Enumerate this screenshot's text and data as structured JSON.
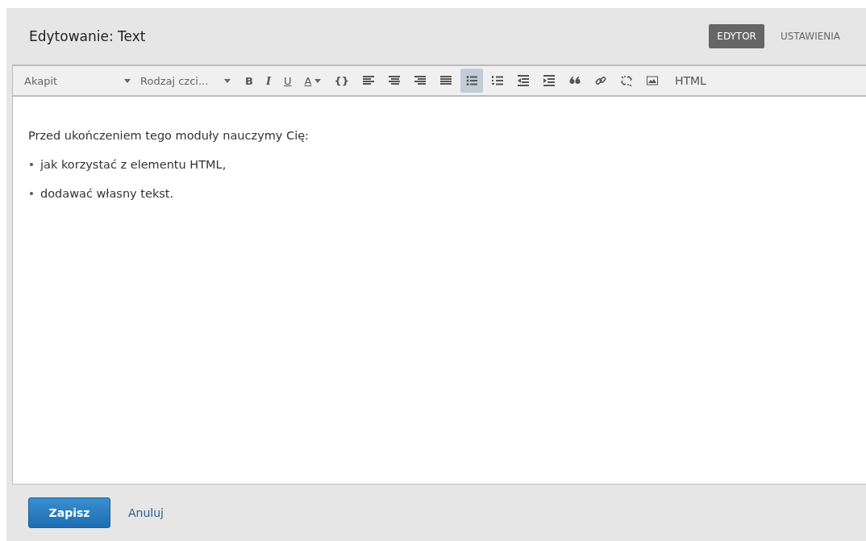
{
  "header": {
    "title": "Edytowanie: Text"
  },
  "tabs": [
    {
      "label": "EDYTOR",
      "selected": true
    },
    {
      "label": "USTAWIENIA",
      "selected": false
    }
  ],
  "toolbar": {
    "dropdowns": [
      {
        "label": "Akapit"
      },
      {
        "label": "Rodzaj czci..."
      }
    ],
    "formats": [
      {
        "label": "B",
        "kind": "bold"
      },
      {
        "label": "I",
        "kind": "italic"
      },
      {
        "label": "U",
        "kind": "underline"
      },
      {
        "label": "A",
        "kind": "color"
      },
      {
        "label": "{}",
        "kind": "code"
      }
    ],
    "tools": [
      {
        "selected": false
      },
      {
        "selected": false
      },
      {
        "selected": false
      },
      {
        "selected": false
      },
      {
        "selected": true
      },
      {
        "selected": false
      },
      {
        "selected": false
      },
      {
        "selected": false
      },
      {
        "selected": false
      },
      {
        "selected": false
      },
      {
        "selected": false
      },
      {
        "selected": false
      }
    ],
    "html_button": "HTML"
  },
  "content": {
    "paragraph": "Przed ukończeniem tego moduły nauczymy Cię:",
    "list": [
      "jak korzystać z elementu HTML,",
      "dodawać własny tekst."
    ]
  },
  "footer": {
    "save": "Zapisz",
    "cancel": "Anuluj"
  }
}
